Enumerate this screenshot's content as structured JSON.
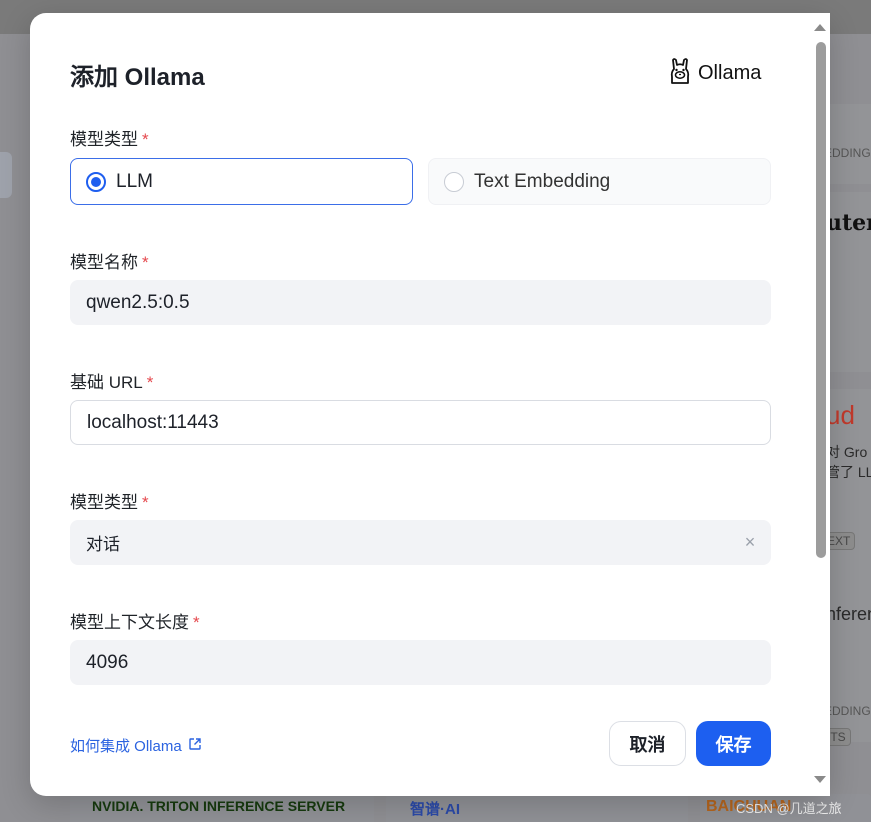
{
  "dialog": {
    "title": "添加 Ollama",
    "brand_name": "Ollama"
  },
  "model_type": {
    "label": "模型类型",
    "options": [
      "LLM",
      "Text Embedding"
    ],
    "selected": "LLM"
  },
  "model_name": {
    "label": "模型名称",
    "value": "qwen2.5:0.5"
  },
  "base_url": {
    "label": "基础 URL",
    "value": "localhost:11443"
  },
  "model_kind": {
    "label": "模型类型",
    "value": "对话"
  },
  "context_length": {
    "label": "模型上下文长度",
    "value": "4096"
  },
  "required_mark": "*",
  "footer": {
    "help_link": "如何集成 Ollama",
    "cancel_label": "取消",
    "save_label": "保存"
  },
  "background": {
    "right_snippets": [
      "EDDING",
      "uter",
      "ud",
      "对 Gro",
      "管了 LL",
      "EXT",
      "nferen",
      "EDDING",
      "ITS"
    ],
    "bottom_logos": [
      "NVIDIA. TRITON INFERENCE SERVER",
      "智谱·AI",
      "BAICHUAN"
    ],
    "watermark": "CSDN @几道之旅"
  },
  "colors": {
    "primary": "#1d5ff0",
    "required": "#e5484d",
    "field_bg": "#f2f3f6"
  }
}
